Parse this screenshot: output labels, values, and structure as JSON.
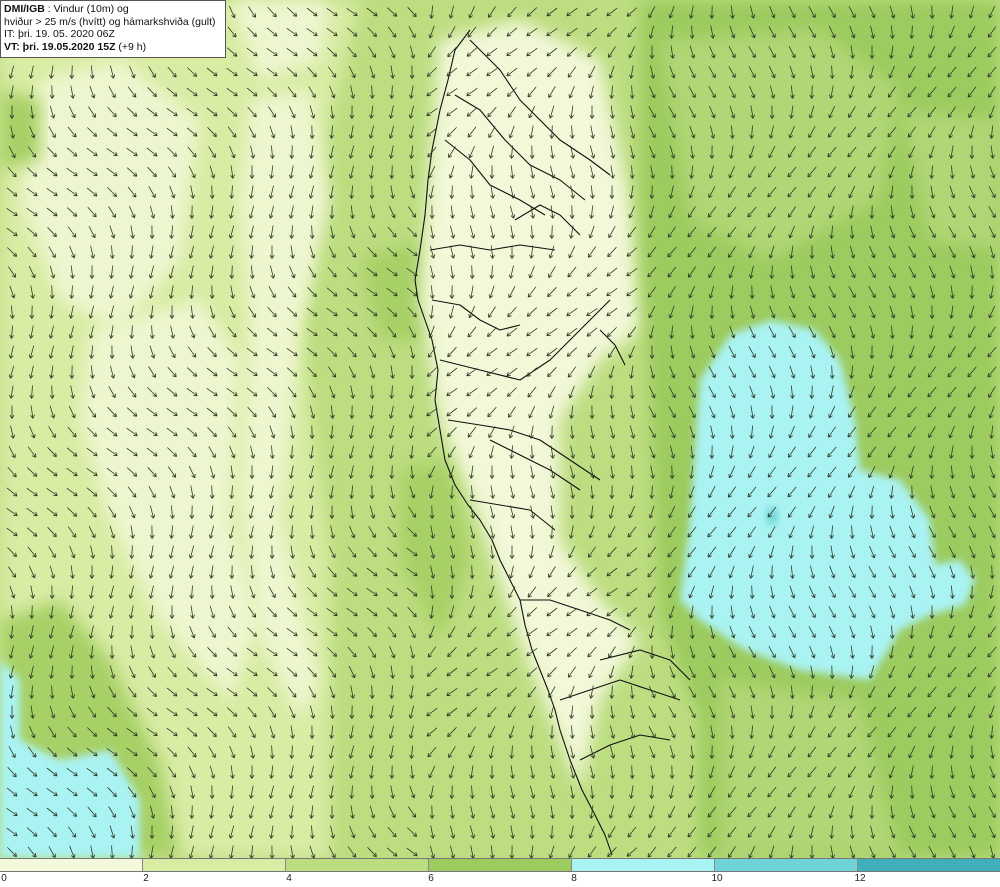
{
  "info": {
    "brand": "DMI/IGB",
    "line1_rest": " : Vindur (10m) og",
    "line2": "hviður > 25 m/s (hvítt) og hámarkshviða (gult)",
    "line3": "IT: þri. 19. 05. 2020 06Z",
    "vt_label": "VT: þri. 19.05.2020 15Z",
    "vt_rest": " (+9 h)"
  },
  "legend": {
    "ticks": [
      "0",
      "2",
      "4",
      "6",
      "8",
      "10",
      "12"
    ],
    "colors": [
      "#f4f9dc",
      "#d8eca4",
      "#bcdd80",
      "#9ccb5e",
      "#aaf3f3",
      "#6fd3d8",
      "#3fb0ba"
    ]
  },
  "colors": {
    "land_outline": "#111111",
    "arrow": "#2d3a25"
  }
}
